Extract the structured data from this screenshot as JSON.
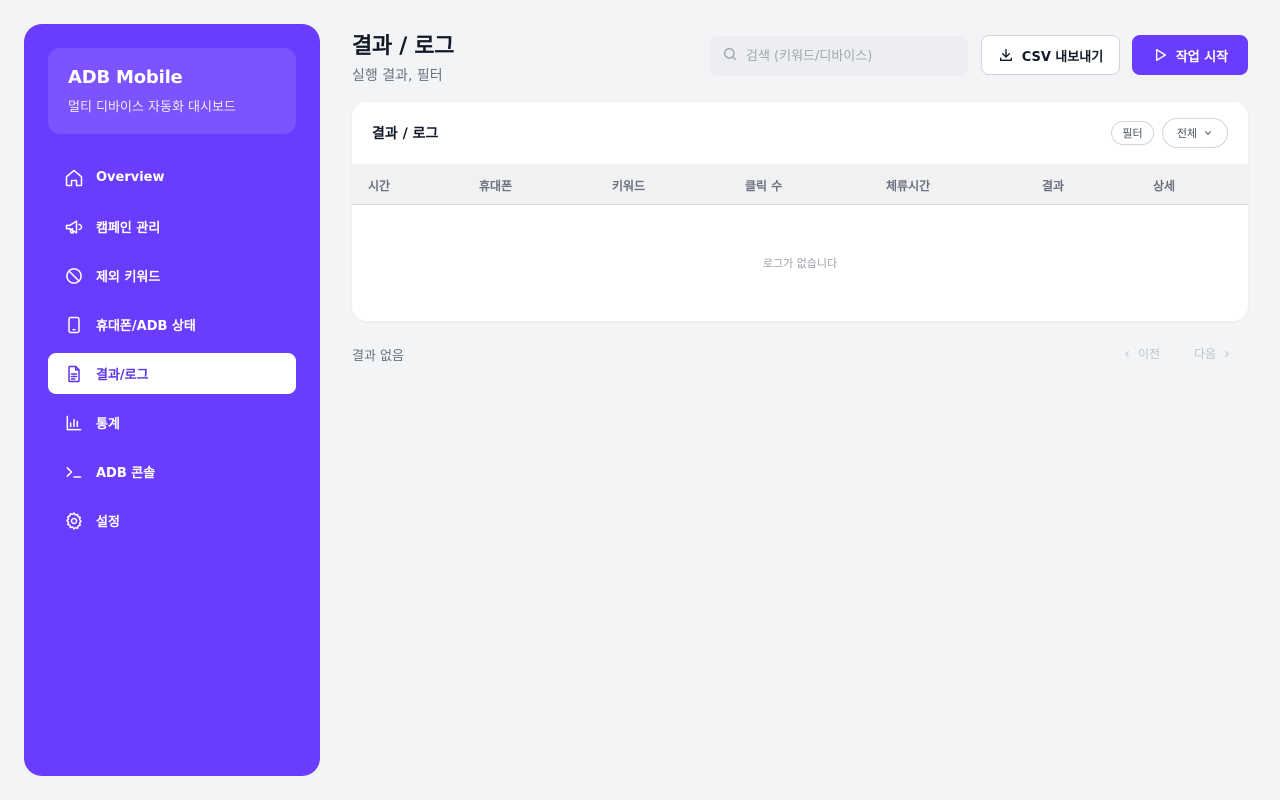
{
  "sidebar": {
    "brand_title": "ADB Mobile",
    "brand_subtitle": "멀티 디바이스 자동화 대시보드",
    "items": [
      {
        "label": "Overview",
        "icon": "home-icon"
      },
      {
        "label": "캠페인 관리",
        "icon": "megaphone-icon"
      },
      {
        "label": "제외 키워드",
        "icon": "ban-icon"
      },
      {
        "label": "휴대폰/ADB 상태",
        "icon": "smartphone-icon"
      },
      {
        "label": "결과/로그",
        "icon": "document-icon",
        "active": true
      },
      {
        "label": "통계",
        "icon": "bar-chart-icon"
      },
      {
        "label": "ADB 콘솔",
        "icon": "terminal-icon"
      },
      {
        "label": "설정",
        "icon": "gear-icon"
      }
    ]
  },
  "header": {
    "title": "결과 / 로그",
    "subtitle": "실행 결과, 필터"
  },
  "toolbar": {
    "search_placeholder": "검색 (키워드/디바이스)",
    "search_value": "",
    "csv_label": "CSV 내보내기",
    "start_label": "작업 시작"
  },
  "card": {
    "title": "결과 / 로그",
    "filter_label": "필터",
    "select_value": "전체",
    "columns": [
      "시간",
      "휴대폰",
      "키워드",
      "클릭 수",
      "체류시간",
      "결과",
      "상세"
    ],
    "empty_text": "로그가 없습니다"
  },
  "footer": {
    "result_count": "결과 없음",
    "prev_label": "이전",
    "next_label": "다음"
  },
  "colors": {
    "accent": "#6a3cff",
    "background": "#f3f4f6"
  }
}
